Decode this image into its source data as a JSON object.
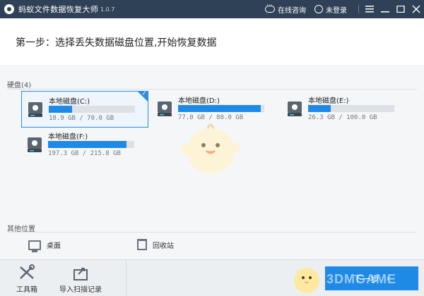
{
  "titlebar": {
    "title": "蚂蚁文件数据恢复大师",
    "version": "1.0.7",
    "online_consult": "在线咨询",
    "not_logged_in": "未登录",
    "menu_icon": "hamburger-icon",
    "minimize_icon": "minimize-icon",
    "maximize_icon": "maximize-icon",
    "close_icon": "close-icon"
  },
  "step": {
    "title": "第一步：选择丢失数据磁盘位置,开始恢复数据"
  },
  "disks": {
    "label": "硬盘(4)",
    "items": [
      {
        "name": "本地磁盘(C:)",
        "size": "18.9 GB / 70.0 GB",
        "used_fraction": 0.27,
        "selected": true
      },
      {
        "name": "本地磁盘(D:)",
        "size": "77.0 GB / 80.0 GB",
        "used_fraction": 0.96,
        "selected": false
      },
      {
        "name": "本地磁盘(E:)",
        "size": "26.3 GB / 100.0 GB",
        "used_fraction": 0.26,
        "selected": false
      },
      {
        "name": "本地磁盘(F:)",
        "size": "197.3 GB / 215.8 GB",
        "used_fraction": 0.91,
        "selected": false
      }
    ]
  },
  "other_locations": {
    "label": "其他位置",
    "desktop": "桌面",
    "recycle_bin": "回收站"
  },
  "bottom": {
    "toolbox": "工具箱",
    "import_scan": "导入扫描记录",
    "next": "下一步",
    "watermark": "3DMGAME"
  },
  "colors": {
    "titlebar": "#2f4157",
    "accent": "#1e8ae6",
    "selected_border": "#2a8de0"
  }
}
